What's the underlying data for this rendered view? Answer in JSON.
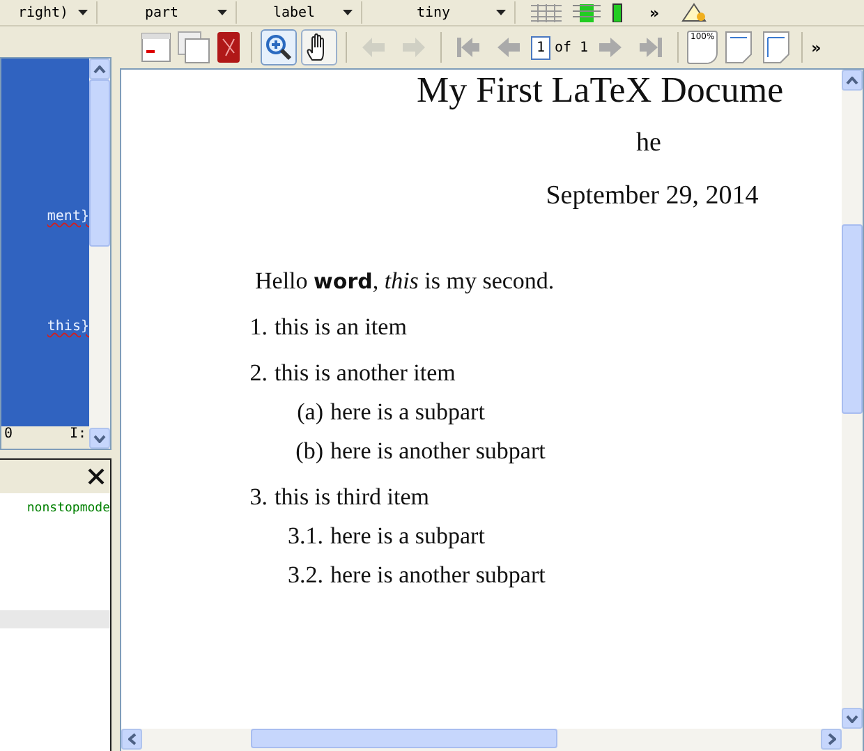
{
  "top_toolbar": {
    "dropdowns": [
      "right)",
      "part",
      "label",
      "tiny"
    ],
    "overflow": "»"
  },
  "pdf_toolbar": {
    "tools": [
      {
        "kind": "zoom",
        "selected": true
      },
      {
        "kind": "hand",
        "selected": false
      }
    ],
    "nav": [
      {
        "kind": "back",
        "disabled": true
      },
      {
        "kind": "forward",
        "disabled": true
      },
      {
        "kind": "first",
        "disabled": true
      },
      {
        "kind": "prev",
        "disabled": true
      }
    ],
    "page": "1",
    "page_total": "of 1",
    "nav_after": [
      {
        "kind": "next",
        "disabled": true
      },
      {
        "kind": "last",
        "disabled": true
      }
    ],
    "zoom_label": "100%",
    "overflow": "»"
  },
  "editor": {
    "lines": [
      {
        "text": "ment}"
      },
      {
        "text": "this}"
      }
    ],
    "status": [
      "0",
      "I:"
    ]
  },
  "log": {
    "lines": [
      "nonstopmode"
    ]
  },
  "document": {
    "title": "My First LaTeX Docume",
    "author": "he",
    "date": "September 29, 2014",
    "paragraph": "Hello **word**, *this* is my second.",
    "items": [
      {
        "label": "1.",
        "text": "this is an item"
      },
      {
        "label": "2.",
        "text": "this is another item",
        "children": [
          {
            "label": "(a)",
            "text": "here is a subpart"
          },
          {
            "label": "(b)",
            "text": "here is another subpart"
          }
        ]
      },
      {
        "label": "3.",
        "text": "this is third item",
        "children": [
          {
            "label": "3.1.",
            "text": "here is a subpart"
          },
          {
            "label": "3.2.",
            "text": "here is another subpart"
          }
        ]
      }
    ]
  }
}
